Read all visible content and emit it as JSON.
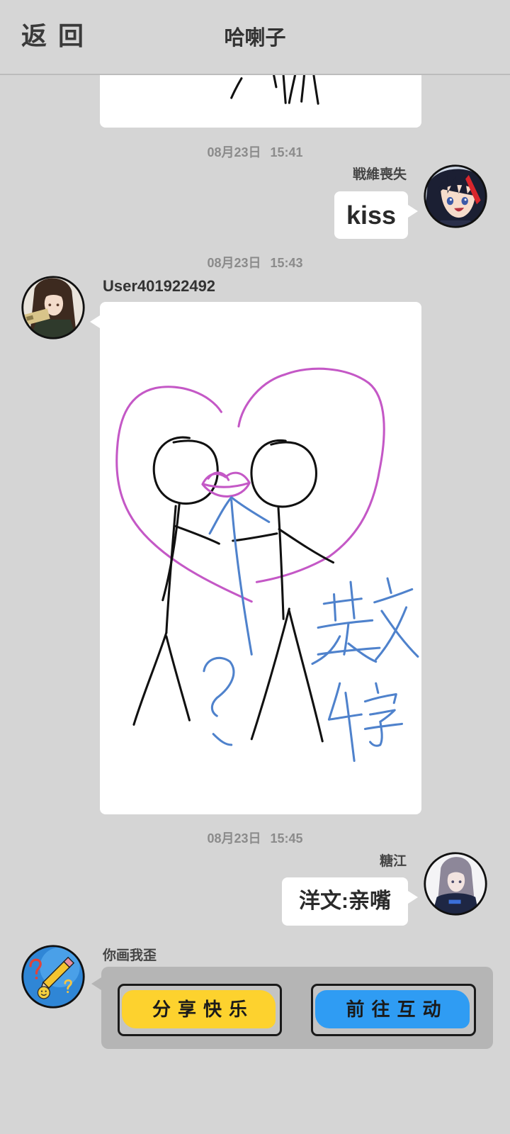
{
  "header": {
    "back_label": "返回",
    "title": "哈喇子"
  },
  "messages": [
    {
      "time": "08月23日 15:41",
      "sender": "戦維喪失",
      "text": "kiss",
      "avatar_icon": "anime-girl-avatar"
    },
    {
      "time": "08月23日 15:43",
      "sender": "User401922492",
      "avatar_icon": "anime-girl-avatar",
      "handwriting": [
        "?",
        "英文",
        "4字"
      ]
    },
    {
      "time": "08月23日 15:45",
      "sender": "糖江",
      "text": "洋文:亲嘴",
      "avatar_icon": "anime-girl-avatar"
    },
    {
      "sender": "你画我歪",
      "avatar_icon": "pencil-logo-icon",
      "buttons": [
        {
          "label": "分享快乐",
          "color": "#fdd22e"
        },
        {
          "label": "前往互动",
          "color": "#2f9cf3"
        }
      ]
    }
  ],
  "colors": {
    "background": "#d5d5d5",
    "bubble": "#ffffff",
    "card": "#b5b5b5",
    "heart_stroke": "#c458c6",
    "handwriting_blue": "#4f82cc",
    "pen_black": "#111111"
  }
}
